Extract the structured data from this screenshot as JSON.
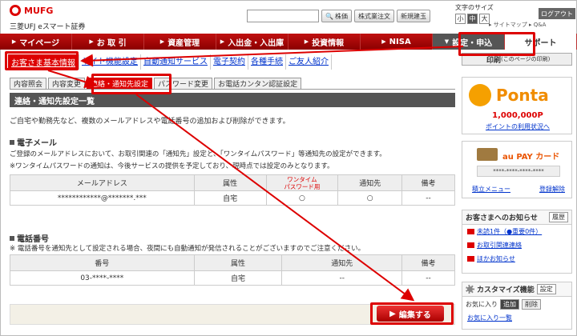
{
  "header": {
    "brand": "MUFG",
    "company": "三菱UFJ eスマート証券",
    "search_btn": "株価",
    "btn_chart": "株式業注文",
    "btn_new": "新規建玉",
    "font_size_label": "文字のサイズ",
    "font_small": "小",
    "font_medium": "中",
    "font_large": "大",
    "logout": "ログアウト",
    "sitemap": "▸ サイトマップ  ▸ Q&A"
  },
  "nav": {
    "items": [
      "マイページ",
      "お 取 引",
      "資産管理",
      "入出金・入出庫",
      "投資情報",
      "NISA",
      "設定・申込",
      "サポート"
    ]
  },
  "subnav": {
    "items": [
      "お客さま基本情報",
      "サイト機能設定",
      "自動通知サービス",
      "電子契約",
      "各種手続",
      "ご友人紹介"
    ]
  },
  "tabs": [
    "内容照会",
    "内容変更",
    "連絡・通知先設定",
    "パスワード変更",
    "お電話カンタン認証設定"
  ],
  "section": {
    "title": "連絡・通知先設定一覧",
    "desc": "ご自宅や勤務先など、複数のメールアドレスや電話番号の追加および削除ができます。"
  },
  "email": {
    "title": "電子メール",
    "note1": "ご登録のメールアドレスにおいて、お取引関連の「通知先」設定と、「ワンタイムパスワード」等通知先の設定ができます。",
    "note2": "※ワンタイムパスワードの通知は、今後サービスの提供を予定しており、現時点では設定のみとなります。",
    "headers": [
      "メールアドレス",
      "属性",
      "ワンタイム\nパスワード用",
      "通知先",
      "備考"
    ],
    "row": [
      "************@*******.***",
      "自宅",
      "○",
      "○",
      "--"
    ]
  },
  "phone": {
    "title": "電話番号",
    "note": "※ 電話番号を通知先として設定される場合、夜間にも自動通知が発信されることがございますのでご注意ください。",
    "headers": [
      "番号",
      "属性",
      "通知先",
      "備考"
    ],
    "row": [
      "03-****-****",
      "自宅",
      "--",
      "--"
    ]
  },
  "edit_button": "編集する",
  "sidebar": {
    "print": "印刷",
    "print_sub": "(このページの印刷)",
    "ponta_title": "Ponta",
    "ponta_points": "1,000,000P",
    "ponta_link": "ポイントの利用状況へ",
    "aupay_title": "au PAY カード",
    "aupay_number": "****-****-****-****",
    "aupay_menu": "積立メニュー",
    "aupay_cancel": "登録解除",
    "notice_title": "お客さまへのお知らせ",
    "notice_history": "履歴",
    "notice_unread": "未読1件（●重要0件）",
    "notice_contact": "お取引関連連絡",
    "notice_other": "ほかお知らせ",
    "custom_title": "カスタマイズ機能",
    "custom_setting": "設定",
    "fav_label": "お気に入り",
    "fav_add": "追加",
    "fav_delete": "削除",
    "fav_list": "お気に入り一覧"
  },
  "colors": {
    "accent": "#d00000",
    "nav": "#8b0000",
    "link": "#0033cc"
  }
}
